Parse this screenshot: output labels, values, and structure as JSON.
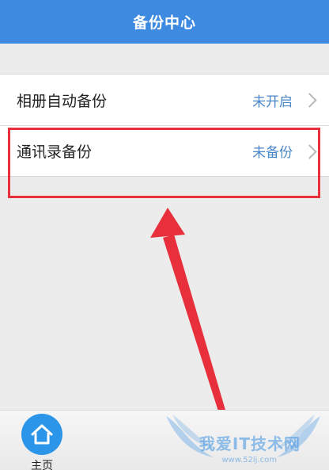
{
  "navbar": {
    "title": "备份中心"
  },
  "settings": {
    "rows": [
      {
        "label": "相册自动备份",
        "value": "未开启"
      },
      {
        "label": "通讯录备份",
        "value": "未备份"
      }
    ]
  },
  "tabbar": {
    "home_label": "主页"
  },
  "watermark": {
    "text": "我爱IT技术网",
    "site": "www.52ij.com"
  },
  "colors": {
    "navbar": "#3d8ae0",
    "value_text": "#4a87c8",
    "highlight": "#e8303c",
    "home_icon_bg": "#2b95e9"
  },
  "icons": {
    "chevron": "chevron-right-icon",
    "home": "home-icon"
  }
}
